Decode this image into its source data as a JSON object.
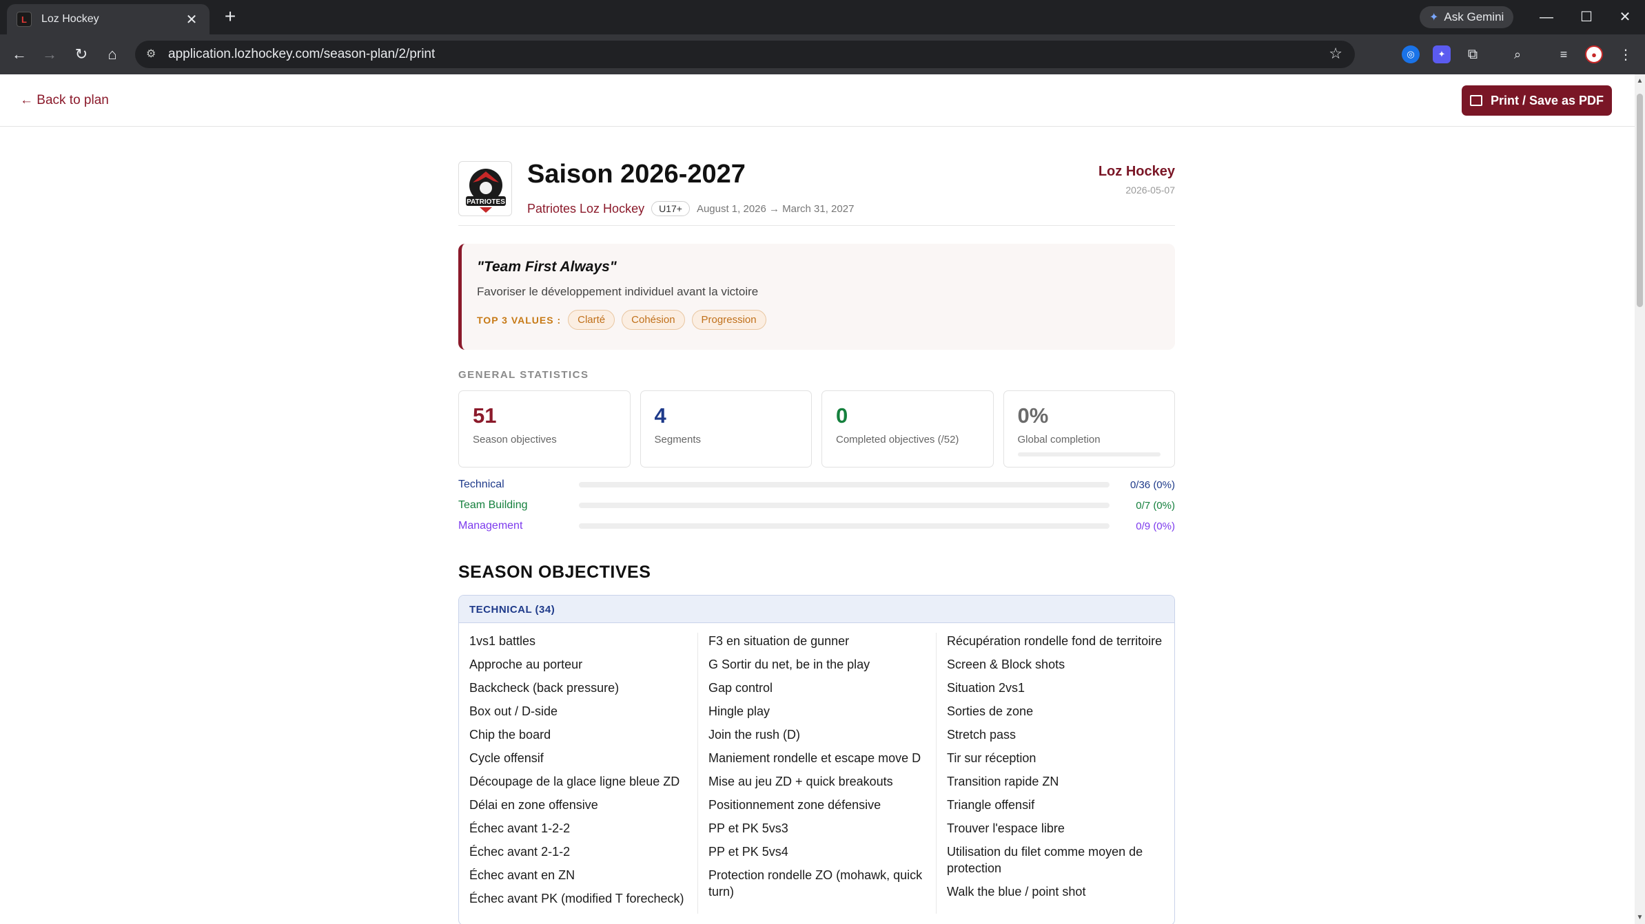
{
  "browser": {
    "tab_title": "Loz Hockey",
    "url": "application.lozhockey.com/season-plan/2/print",
    "gemini_label": "Ask Gemini"
  },
  "topbar": {
    "back_label": "← Back to plan",
    "print_label": "Print / Save as PDF"
  },
  "header": {
    "title": "Saison 2026-2027",
    "team": "Patriotes Loz Hockey",
    "category": "U17+",
    "dates": "August 1, 2026 → March 31, 2027",
    "club": "Loz Hockey",
    "generated_date": "2026-05-07",
    "logo_text": "PATRIOTES"
  },
  "motto": {
    "title": "\"Team First Always\"",
    "description": "Favoriser le développement individuel avant la victoire",
    "values_label": "TOP 3 VALUES :",
    "values": [
      "Clarté",
      "Cohésion",
      "Progression"
    ]
  },
  "stats": {
    "section_label": "GENERAL STATISTICS",
    "cards": [
      {
        "value": "51",
        "label": "Season objectives",
        "color": "#8b1a2b"
      },
      {
        "value": "4",
        "label": "Segments",
        "color": "#1e3a8a"
      },
      {
        "value": "0",
        "label": "Completed objectives (/52)",
        "color": "#15803d"
      },
      {
        "value": "0%",
        "label": "Global completion",
        "color": "#6b6b6b",
        "progress": 0
      }
    ],
    "categories": [
      {
        "name": "Technical",
        "value": "0/36 (0%)",
        "color": "#1e3a8a",
        "progress": 0
      },
      {
        "name": "Team Building",
        "value": "0/7 (0%)",
        "color": "#15803d",
        "progress": 0
      },
      {
        "name": "Management",
        "value": "0/9 (0%)",
        "color": "#7c3aed",
        "progress": 0
      }
    ]
  },
  "objectives": {
    "title": "SEASON OBJECTIVES",
    "technical": {
      "header": "TECHNICAL (34)",
      "col1": [
        "1vs1 battles",
        "Approche au porteur",
        "Backcheck (back pressure)",
        "Box out / D-side",
        "Chip the board",
        "Cycle offensif",
        "Découpage de la glace ligne bleue ZD",
        "Délai en zone offensive",
        "Échec avant 1-2-2",
        "Échec avant 2-1-2",
        "Échec avant en ZN",
        "Échec avant PK (modified T forecheck)"
      ],
      "col2": [
        "F3 en situation de gunner",
        "G Sortir du net, be in the play",
        "Gap control",
        "Hingle play",
        "Join the rush (D)",
        "Maniement rondelle et escape move D",
        "Mise au jeu ZD + quick breakouts",
        "Positionnement zone défensive",
        "PP et PK 5vs3",
        "PP et PK 5vs4",
        "Protection rondelle ZO (mohawk, quick turn)"
      ],
      "col3": [
        "Récupération rondelle fond de territoire",
        "Screen & Block shots",
        "Situation 2vs1",
        "Sorties de zone",
        "Stretch pass",
        "Tir sur réception",
        "Transition rapide ZN",
        "Triangle offensif",
        "Trouver l'espace libre",
        "Utilisation du filet comme moyen de protection",
        "Walk the blue / point shot"
      ]
    }
  }
}
